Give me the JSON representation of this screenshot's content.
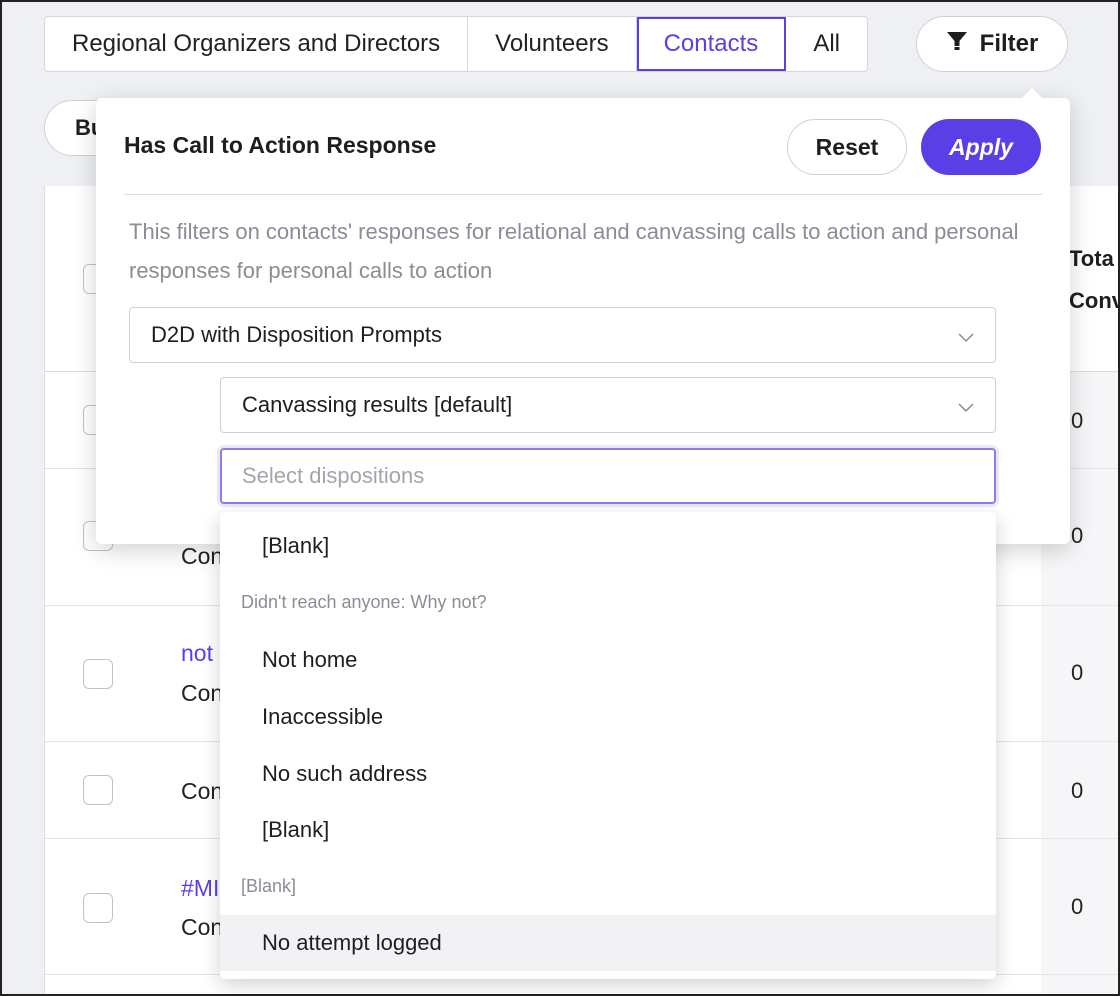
{
  "tabs": [
    {
      "label": "Regional Organizers and Directors",
      "active": false
    },
    {
      "label": "Volunteers",
      "active": false
    },
    {
      "label": "Contacts",
      "active": true
    },
    {
      "label": "All",
      "active": false
    }
  ],
  "filter_button": {
    "label": "Filter",
    "icon": "funnel-icon"
  },
  "bulk_button": {
    "label": "Bu"
  },
  "table": {
    "header": {
      "total_label_line1": "Tota",
      "total_label_line2": "Conv"
    },
    "rows": [
      {
        "link": "",
        "text": "",
        "total": "0"
      },
      {
        "link": "",
        "text": "Con",
        "total": "0"
      },
      {
        "link": "not",
        "text": "Con",
        "total": "0"
      },
      {
        "link": "",
        "text": "Con",
        "total": "0"
      },
      {
        "link": "#MI",
        "text": "Con",
        "total": "0"
      }
    ]
  },
  "filter_panel": {
    "title": "Has Call to Action Response",
    "reset_label": "Reset",
    "apply_label": "Apply",
    "description": "This filters on contacts' responses for relational and canvassing calls to action and personal responses for personal calls to action",
    "select_call_to_action": "D2D with Disposition Prompts",
    "select_script": "Canvassing results [default]",
    "dispositions_placeholder": "Select dispositions"
  },
  "dispositions_menu": {
    "top_option": "[Blank]",
    "group1_label": "Didn't reach anyone: Why not?",
    "group1_options": [
      "Not home",
      "Inaccessible",
      "No such address",
      "[Blank]"
    ],
    "group2_label": "[Blank]",
    "group2_options": [
      "No attempt logged"
    ]
  },
  "colors": {
    "accent": "#5b3fe6",
    "background": "#eef0f4"
  }
}
